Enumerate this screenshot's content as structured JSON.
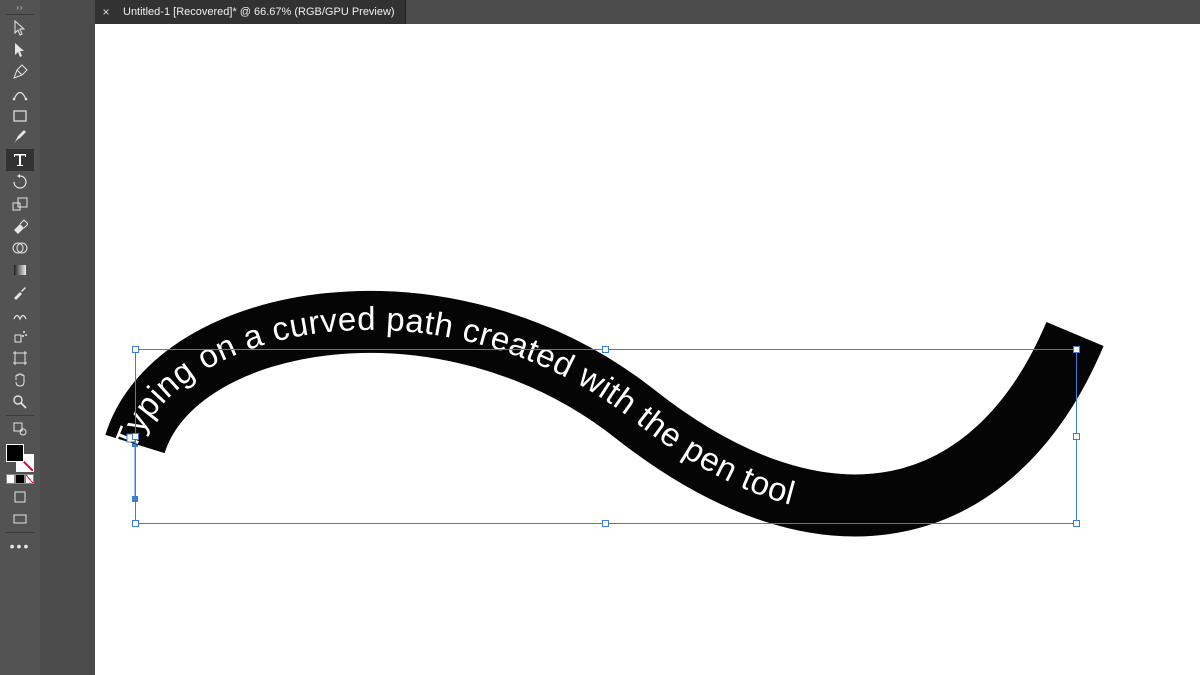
{
  "tab": {
    "close_glyph": "×",
    "title": "Untitled-1 [Recovered]* @ 66.67% (RGB/GPU Preview)"
  },
  "artwork": {
    "text": "Typing on a curved path created with the pen tool"
  },
  "tools": {
    "selection": "selection-tool",
    "direct": "direct-selection-tool",
    "pen": "pen-tool",
    "curvature": "curvature-tool",
    "rect": "rectangle-tool",
    "brush": "paintbrush-tool",
    "type": "type-tool",
    "rotate": "rotate-tool",
    "reflect": "scale-tool",
    "eraser": "eraser-tool",
    "shapebuilder": "shape-builder-tool",
    "gradient": "gradient-tool",
    "eyedropper": "eyedropper-tool",
    "blend": "blend-tool",
    "symbol": "symbol-sprayer-tool",
    "artboard": "artboard-tool",
    "hand": "hand-tool",
    "zoom": "zoom-tool"
  },
  "colors": {
    "selection_blue": "#3b7dd8",
    "ui_dark": "#535353",
    "ui_darker": "#323232"
  }
}
